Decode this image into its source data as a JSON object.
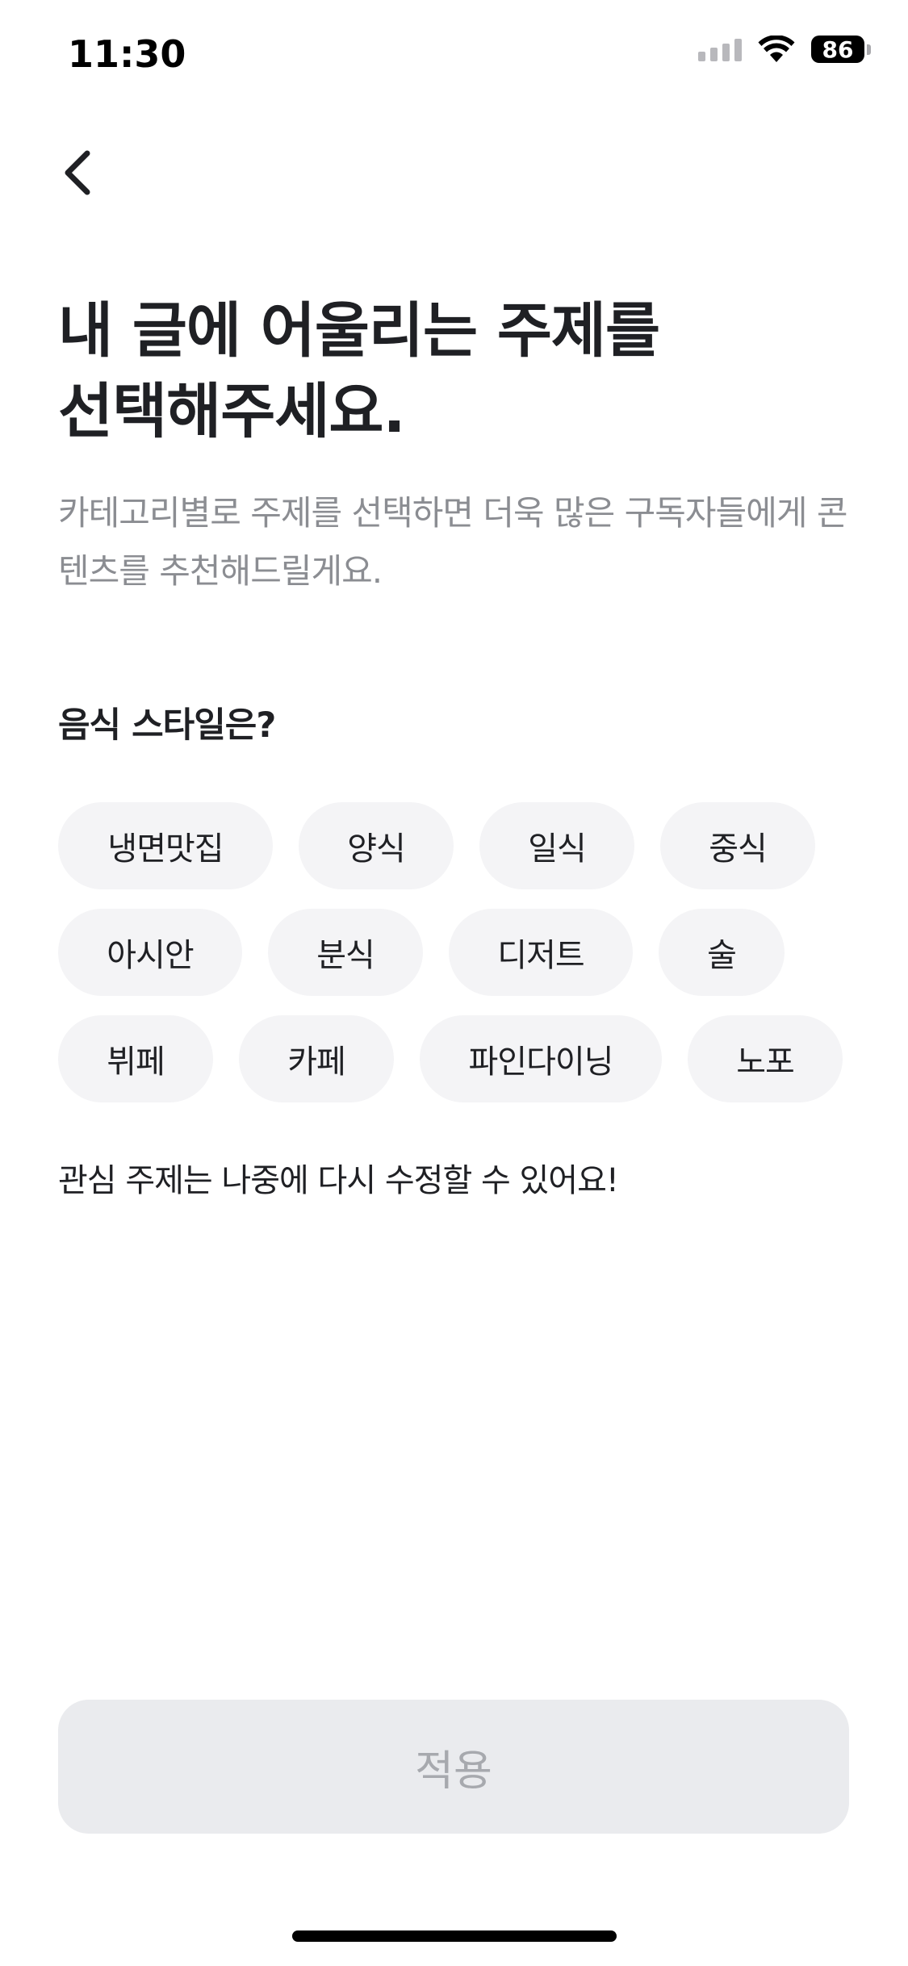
{
  "status_bar": {
    "time": "11:30",
    "battery_level": "86",
    "icons": [
      "signal-icon",
      "wifi-icon",
      "battery-icon"
    ]
  },
  "nav": {
    "back_icon": "chevron-left-icon"
  },
  "header": {
    "title": "내 글에 어울리는 주제를\n선택해주세요.",
    "subtitle": "카테고리별로 주제를 선택하면 더욱 많은 구독자들에게 콘텐츠를 추천해드릴게요."
  },
  "section": {
    "title": "음식 스타일은?",
    "options": [
      [
        "냉면맛집",
        "양식",
        "일식",
        "중식"
      ],
      [
        "아시안",
        "분식",
        "디저트",
        "술"
      ],
      [
        "뷔페",
        "카페",
        "파인다이닝",
        "노포"
      ]
    ]
  },
  "note": "관심 주제는 나중에 다시 수정할 수 있어요!",
  "apply_button": {
    "label": "적용",
    "enabled": false
  },
  "colors": {
    "text_primary": "#1f2024",
    "text_secondary": "#8b8d92",
    "chip_background": "#f4f4f6",
    "button_disabled_bg": "#eaebee",
    "button_disabled_text": "#a7a9ae"
  }
}
